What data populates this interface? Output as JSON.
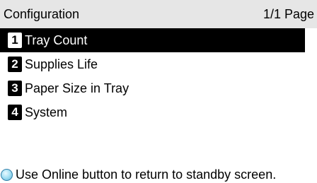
{
  "header": {
    "title": "Configuration",
    "page_indicator": "1/1 Page"
  },
  "menu": {
    "selected_index": 0,
    "items": [
      {
        "number": "1",
        "label": "Tray Count"
      },
      {
        "number": "2",
        "label": "Supplies Life"
      },
      {
        "number": "3",
        "label": "Paper Size in Tray"
      },
      {
        "number": "4",
        "label": "System"
      }
    ]
  },
  "footer": {
    "icon": "online-button-icon",
    "icon_color": "#a9e2f5",
    "message": "Use Online button to return to standby screen."
  },
  "colors": {
    "header_background": "#e6e6e6",
    "selected_background": "#000000",
    "selected_text": "#ffffff"
  }
}
